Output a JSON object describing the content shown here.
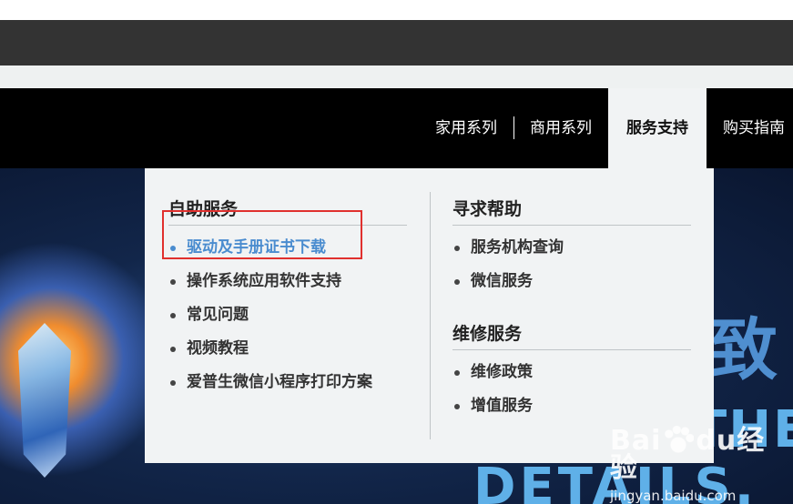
{
  "nav": {
    "items": [
      {
        "label": "家用系列"
      },
      {
        "label": "商用系列"
      },
      {
        "label": "服务支持",
        "active": true
      },
      {
        "label": "购买指南"
      }
    ]
  },
  "dropdown": {
    "self_service": {
      "title": "自助服务",
      "items": [
        {
          "label": "驱动及手册证书下载",
          "highlighted": true
        },
        {
          "label": "操作系统应用软件支持"
        },
        {
          "label": "常见问题"
        },
        {
          "label": "视频教程"
        },
        {
          "label": "爱普生微信小程序打印方案"
        }
      ]
    },
    "seek_help": {
      "title": "寻求帮助",
      "items": [
        {
          "label": "服务机构查询"
        },
        {
          "label": "微信服务"
        }
      ]
    },
    "repair_service": {
      "title": "维修服务",
      "items": [
        {
          "label": "维修政策"
        },
        {
          "label": "增值服务"
        }
      ]
    }
  },
  "hero": {
    "char": "致",
    "word1": "THE",
    "word2": "DETAILS."
  },
  "watermark": {
    "logo_left": "Bai",
    "logo_mid": "du",
    "logo_right": "经验",
    "url": "jingyan.baidu.com"
  },
  "colors": {
    "nav_bg": "#000000",
    "dropdown_bg": "#f1f3f4",
    "highlight": "#4a8ccf",
    "annotation_box": "#e0302e"
  }
}
